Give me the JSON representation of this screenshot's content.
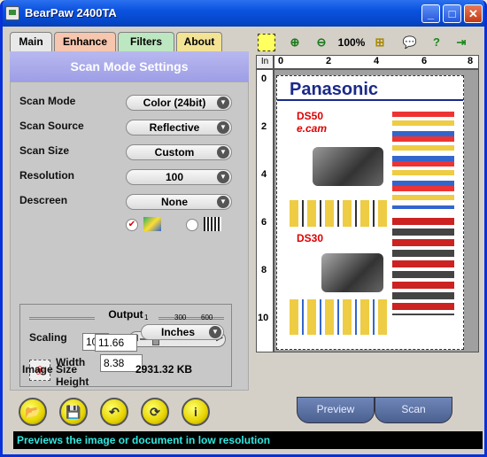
{
  "window": {
    "title": "BearPaw 2400TA"
  },
  "tabs": [
    {
      "label": "Main",
      "color": "#e8e8e8"
    },
    {
      "label": "Enhance",
      "color": "#f7c6ae"
    },
    {
      "label": "Filters",
      "color": "#bde7c0"
    },
    {
      "label": "About",
      "color": "#f3e394"
    }
  ],
  "panel_title": "Scan Mode Settings",
  "settings": [
    {
      "label": "Scan Mode",
      "value": "Color (24bit)"
    },
    {
      "label": "Scan Source",
      "value": "Reflective"
    },
    {
      "label": "Scan Size",
      "value": "Custom"
    },
    {
      "label": "Resolution",
      "value": "100"
    },
    {
      "label": "Descreen",
      "value": "None"
    }
  ],
  "output": {
    "title": "Output",
    "scaling_label": "Scaling",
    "scaling_value": "100",
    "scaling_unit": "%",
    "slider_ticks": [
      "1",
      "300",
      "600"
    ],
    "width_label": "Width",
    "width_value": "8.38",
    "height_label": "Height",
    "height_value": "11.66",
    "unit": "Inches",
    "image_size_label": "Image Size",
    "image_size_value": "2931.32 KB"
  },
  "toolbar": {
    "zoom_level": "100%"
  },
  "ruler": {
    "unit": "In",
    "h_ticks": [
      "0",
      "2",
      "4",
      "6",
      "8"
    ],
    "v_ticks": [
      "0",
      "2",
      "4",
      "6",
      "8",
      "10"
    ]
  },
  "buttons": {
    "preview": "Preview",
    "scan": "Scan"
  },
  "status": "Previews the image or document in low resolution",
  "preview_doc": {
    "brand": "Panasonic",
    "model1": "DS50",
    "sub1": "e.cam",
    "model2": "DS30"
  },
  "colors": {
    "titlebar": "#0a52de",
    "banner": "#9e9ee6",
    "status_text": "#2ee8e0"
  }
}
